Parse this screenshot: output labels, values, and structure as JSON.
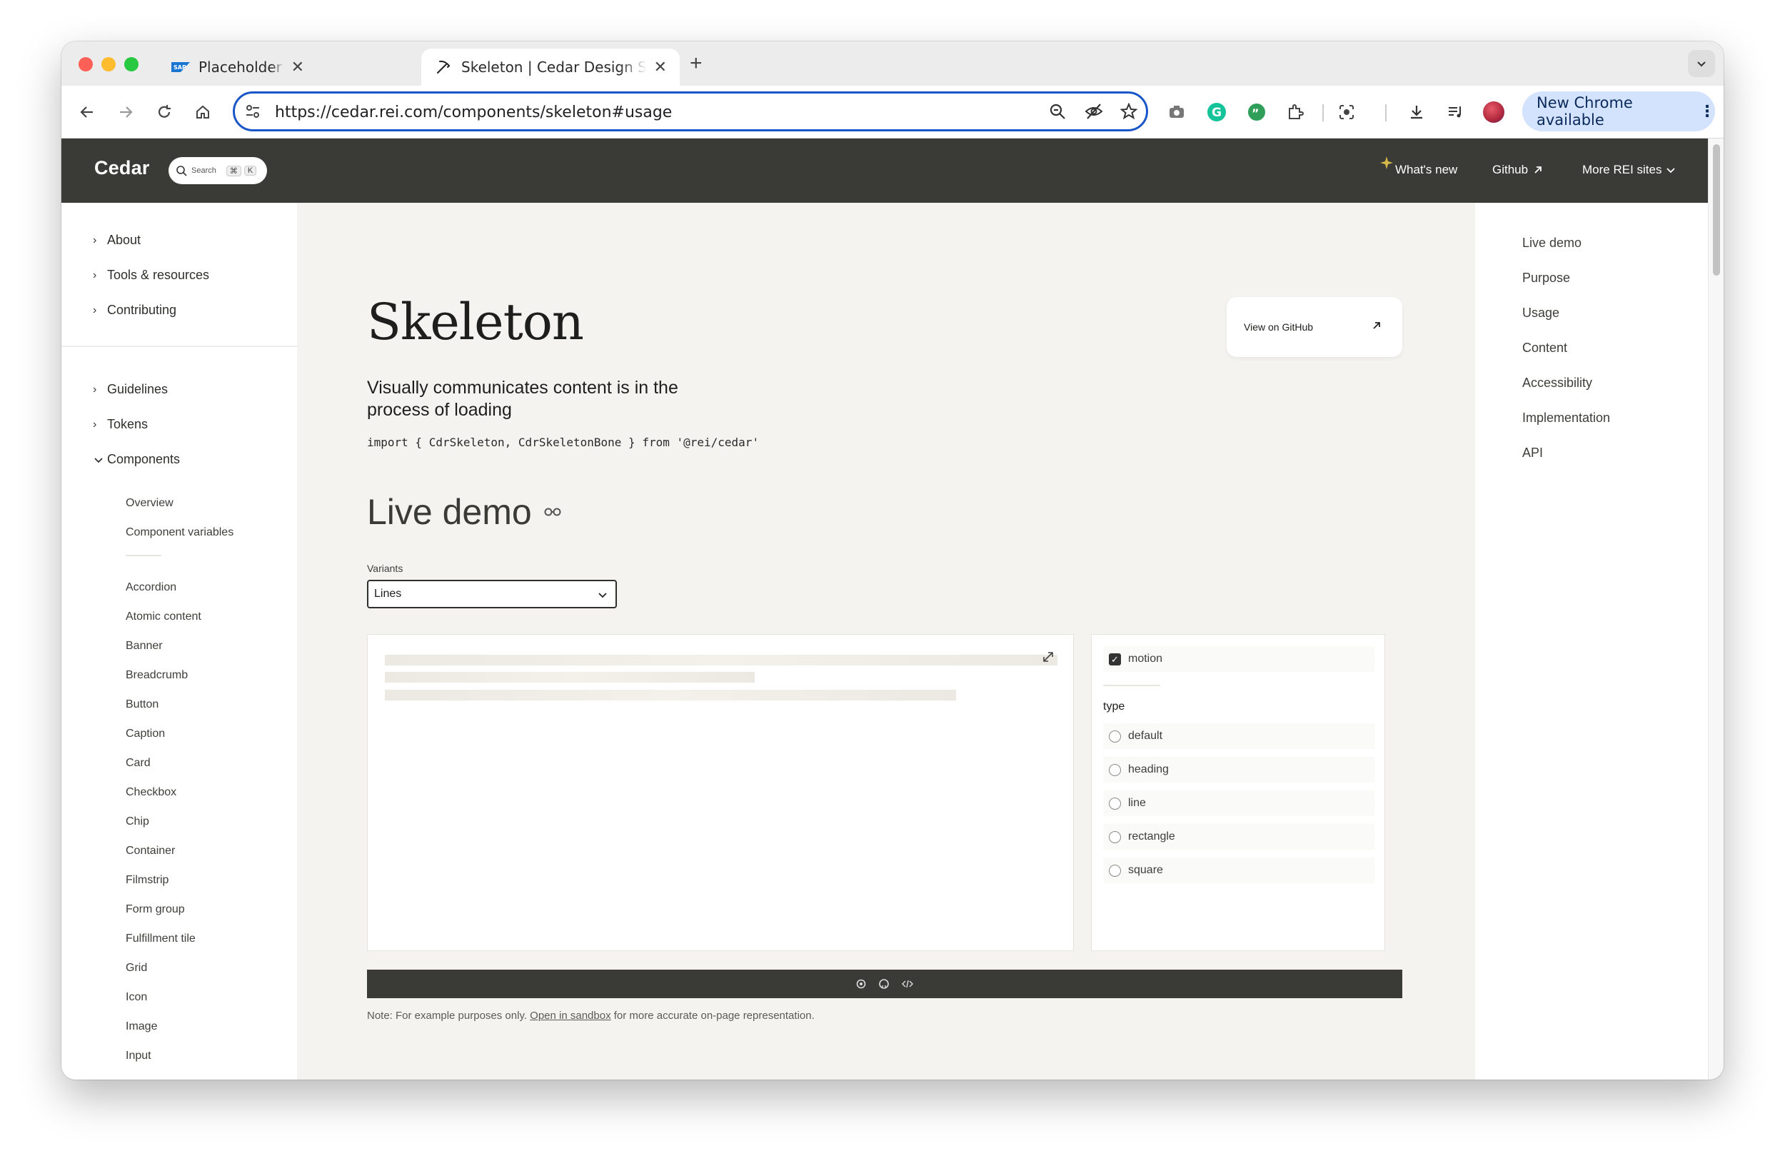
{
  "browser": {
    "tabs": [
      {
        "title": "Placeholder Loading | SAP Fio",
        "icon": "sap-logo-icon"
      },
      {
        "title": "Skeleton | Cedar Design Syste",
        "icon": "pickaxe-icon"
      }
    ],
    "url": "https://cedar.rei.com/components/skeleton#usage",
    "update_label": "New Chrome available"
  },
  "site": {
    "brand": "Cedar",
    "search_placeholder": "Search",
    "search_kbd1": "⌘",
    "search_kbd2": "K",
    "nav": {
      "whats_new": "What's new",
      "github": "Github",
      "more": "More REI sites"
    }
  },
  "leftnav": {
    "groups_top": [
      "About",
      "Tools & resources",
      "Contributing"
    ],
    "groups_mid": [
      "Guidelines",
      "Tokens"
    ],
    "components_label": "Components",
    "sub_intro": [
      "Overview",
      "Component variables"
    ],
    "sub_items": [
      "Accordion",
      "Atomic content",
      "Banner",
      "Breadcrumb",
      "Button",
      "Caption",
      "Card",
      "Checkbox",
      "Chip",
      "Container",
      "Filmstrip",
      "Form group",
      "Fulfillment tile",
      "Grid",
      "Icon",
      "Image",
      "Input"
    ]
  },
  "rightnav": [
    "Live demo",
    "Purpose",
    "Usage",
    "Content",
    "Accessibility",
    "Implementation",
    "API"
  ],
  "main": {
    "title": "Skeleton",
    "lede": "Visually communicates content is in the process of loading",
    "import_code": "import { CdrSkeleton, CdrSkeletonBone } from '@rei/cedar'",
    "github_card": "View on GitHub",
    "live_demo": "Live demo",
    "variants_label": "Variants",
    "variant_selected": "Lines",
    "controls": {
      "motion_label": "motion",
      "type_label": "type",
      "types": [
        "default",
        "heading",
        "line",
        "rectangle",
        "square"
      ]
    },
    "note_prefix": "Note: For example purposes only. ",
    "note_link": "Open in sandbox",
    "note_suffix": " for more accurate on-page representation."
  },
  "colors": {
    "header_bg": "#3a3a37",
    "page_bg": "#f4f3f0",
    "url_ring": "#1a56c7",
    "update_pill": "#d3e3fd"
  }
}
